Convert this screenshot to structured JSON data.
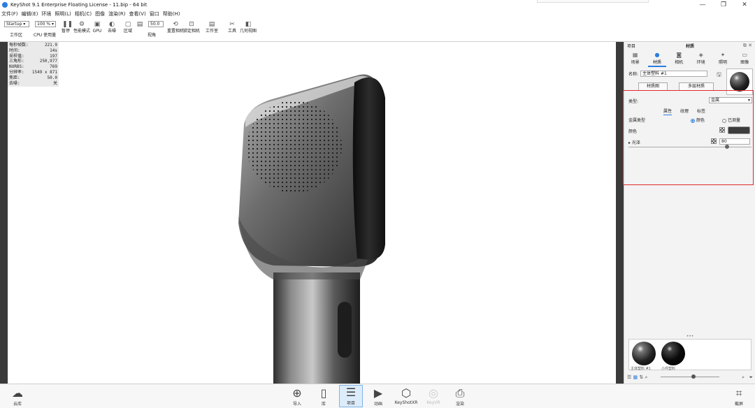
{
  "window": {
    "title": "KeyShot 9.1 Enterprise Floating License - 11.bip - 64 bit",
    "controls": [
      "—",
      "❐",
      "✕"
    ]
  },
  "menu": [
    "文件(F)",
    "编辑(E)",
    "环境",
    "照明(L)",
    "相机(C)",
    "图像",
    "渲染(R)",
    "查看(V)",
    "窗口",
    "帮助(H)"
  ],
  "toolbar": {
    "mode_select": "Startup",
    "zoom_select": "100 %",
    "workspace_label": "工作区",
    "cpu_label": "CPU 使用量",
    "pause_label": "暂停",
    "perf_label": "性能模式",
    "gpu_label": "GPU",
    "denoise_label": "去噪",
    "region_label": "区域",
    "fov_value": "50.0",
    "view_label": "视角",
    "reset_label": "重置相机",
    "lock_label": "锁定相机",
    "studio_label": "工作室",
    "tools_label": "工具",
    "geometry_label": "几何视图"
  },
  "stats": [
    {
      "k": "每秒帧数:",
      "v": "221.9"
    },
    {
      "k": "时间:",
      "v": "14s"
    },
    {
      "k": "采样值:",
      "v": "197"
    },
    {
      "k": "三角形:",
      "v": "250,977"
    },
    {
      "k": "NURBS:",
      "v": "769"
    },
    {
      "k": "分辨率:",
      "v": "1549 x 871"
    },
    {
      "k": "焦距:",
      "v": "50.0"
    },
    {
      "k": "去噪:",
      "v": "关"
    }
  ],
  "panel": {
    "header_left": "项目",
    "header_title": "材质",
    "header_controls": "⧉ ✕",
    "tabs": [
      {
        "label": "场景",
        "icon": "scene-icon",
        "glyph": "▦"
      },
      {
        "label": "材质",
        "icon": "material-icon",
        "glyph": "●"
      },
      {
        "label": "相机",
        "icon": "camera-icon",
        "glyph": "◙"
      },
      {
        "label": "环境",
        "icon": "environment-icon",
        "glyph": "◈"
      },
      {
        "label": "照明",
        "icon": "lighting-icon",
        "glyph": "✦"
      },
      {
        "label": "图像",
        "icon": "image-icon",
        "glyph": "▭"
      }
    ],
    "name_label": "名称:",
    "name_value": "主体塑料 #1",
    "material_graph_label": "材质图",
    "multi_layer_label": "多层材质",
    "type_label": "类型:",
    "type_value": "金属",
    "subtabs": [
      "属性",
      "纹理",
      "标签"
    ],
    "metal_type_label": "金属类型",
    "radio_color": "颜色",
    "radio_measured": "已测量",
    "color_label": "颜色",
    "accent_color": "#3c3c3c",
    "gloss_label": "光泽",
    "gloss_value": "80",
    "gloss_level": 0.8,
    "lib_captions": [
      "主体塑料 #1",
      "小件塑料"
    ]
  },
  "bottombar": [
    {
      "label": "云库",
      "icon": "cloud-icon",
      "glyph": "☁"
    },
    {
      "label": "导入",
      "icon": "import-icon",
      "glyph": "⊕"
    },
    {
      "label": "库",
      "icon": "library-icon",
      "glyph": "▯"
    },
    {
      "label": "项目",
      "icon": "project-icon",
      "glyph": "☰"
    },
    {
      "label": "动画",
      "icon": "animation-icon",
      "glyph": "▶"
    },
    {
      "label": "KeyShotXR",
      "icon": "keyshotxr-icon",
      "glyph": "⬡"
    },
    {
      "label": "KeyVR",
      "icon": "keyvr-icon",
      "glyph": "◎"
    },
    {
      "label": "渲染",
      "icon": "render-icon",
      "glyph": "⎙"
    },
    {
      "label": "截屏",
      "icon": "screenshot-icon",
      "glyph": "⌗"
    }
  ]
}
